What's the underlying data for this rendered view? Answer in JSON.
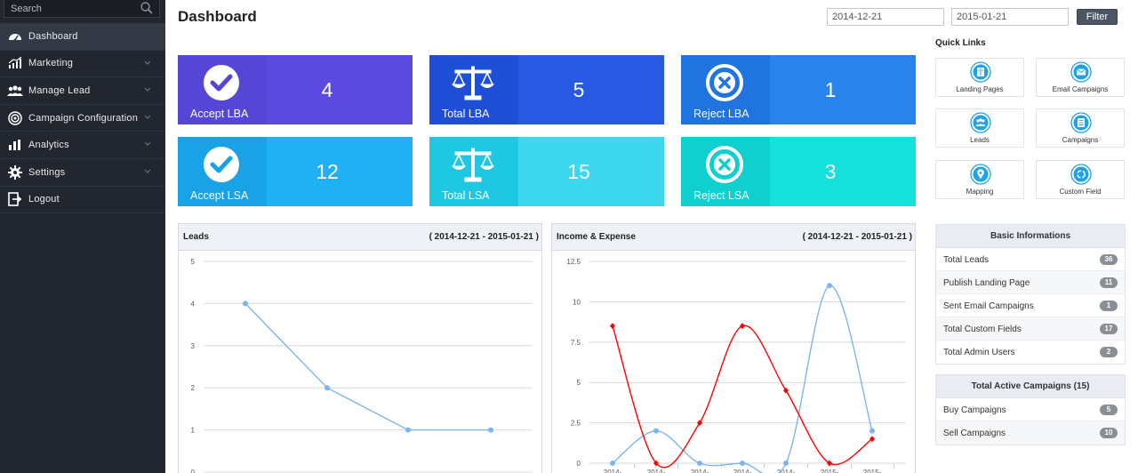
{
  "sidebar": {
    "search_placeholder": "Search",
    "items": [
      {
        "label": "Dashboard",
        "icon": "dashboard-icon"
      },
      {
        "label": "Marketing",
        "icon": "chart-up-icon"
      },
      {
        "label": "Manage Lead",
        "icon": "users-icon"
      },
      {
        "label": "Campaign Configuration",
        "icon": "target-icon"
      },
      {
        "label": "Analytics",
        "icon": "bar-chart-icon"
      },
      {
        "label": "Settings",
        "icon": "gear-icon"
      },
      {
        "label": "Logout",
        "icon": "logout-icon"
      }
    ]
  },
  "header": {
    "title": "Dashboard",
    "date_from": "2014-12-21",
    "date_to": "2015-01-21",
    "filter_label": "Filter"
  },
  "tiles": [
    {
      "label": "Accept LBA",
      "value": "4",
      "icon": "check-circle-icon",
      "icon_color": "#5546d6",
      "value_color": "#5c49df"
    },
    {
      "label": "Total LBA",
      "value": "5",
      "icon": "scale-icon",
      "icon_color": "#1f4fd6",
      "value_color": "#2759e3"
    },
    {
      "label": "Reject LBA",
      "value": "1",
      "icon": "x-circle-icon",
      "icon_color": "#1f74df",
      "value_color": "#2883ea"
    },
    {
      "label": "Accept LSA",
      "value": "12",
      "icon": "check-circle-icon",
      "icon_color": "#1aa2e6",
      "value_color": "#1fb1f3"
    },
    {
      "label": "Total LSA",
      "value": "15",
      "icon": "scale-icon",
      "icon_color": "#1fc8e2",
      "value_color": "#3dd8ef"
    },
    {
      "label": "Reject LSA",
      "value": "3",
      "icon": "x-circle-icon",
      "icon_color": "#10cfcf",
      "value_color": "#14e0dc"
    }
  ],
  "leads_panel": {
    "title": "Leads",
    "range": "( 2014-12-21 - 2015-01-21 )",
    "chart_data": {
      "type": "line",
      "y_ticks": [
        "5",
        "4",
        "3",
        "2",
        "1",
        "0"
      ],
      "ylim": [
        0,
        5
      ],
      "series": [
        {
          "values": [
            4,
            2,
            1,
            1
          ],
          "color": "#7cb5ec"
        }
      ]
    }
  },
  "income_panel": {
    "title": "Income & Expense",
    "range": "( 2014-12-21 - 2015-01-21 )",
    "chart_data": {
      "type": "line",
      "y_ticks": [
        "12.5",
        "10",
        "7.5",
        "5",
        "2.5",
        "0"
      ],
      "ylim": [
        0,
        12.5
      ],
      "x_ticks": [
        "2014-",
        "2014-",
        "2014-",
        "2014-",
        "2014-",
        "2015-",
        "2015-"
      ],
      "series": [
        {
          "values": [
            0,
            2,
            0,
            0,
            0,
            11,
            2
          ],
          "color": "#7cb5ec"
        },
        {
          "values": [
            8.5,
            0,
            2.5,
            8.5,
            4.5,
            0,
            1.5
          ],
          "color": "#ff0000"
        }
      ]
    }
  },
  "quick_links": {
    "title": "Quick Links",
    "items": [
      {
        "label": "Landing Pages",
        "icon": "landing-page-icon"
      },
      {
        "label": "Email Campaigns",
        "icon": "envelope-icon"
      },
      {
        "label": "Leads",
        "icon": "people-icon"
      },
      {
        "label": "Campaigns",
        "icon": "document-icon"
      },
      {
        "label": "Mapping",
        "icon": "map-pin-icon"
      },
      {
        "label": "Custom Field",
        "icon": "refresh-icon"
      }
    ]
  },
  "basic_info": {
    "title": "Basic Informations",
    "rows": [
      {
        "label": "Total Leads",
        "count": "36"
      },
      {
        "label": "Publish Landing Page",
        "count": "11"
      },
      {
        "label": "Sent Email Campaigns",
        "count": "1"
      },
      {
        "label": "Total Custom Fields",
        "count": "17"
      },
      {
        "label": "Total Admin Users",
        "count": "2"
      }
    ]
  },
  "active_campaigns": {
    "title": "Total Active Campaigns (15)",
    "rows": [
      {
        "label": "Buy Campaigns",
        "count": "5"
      },
      {
        "label": "Sell Campaigns",
        "count": "10"
      }
    ]
  }
}
